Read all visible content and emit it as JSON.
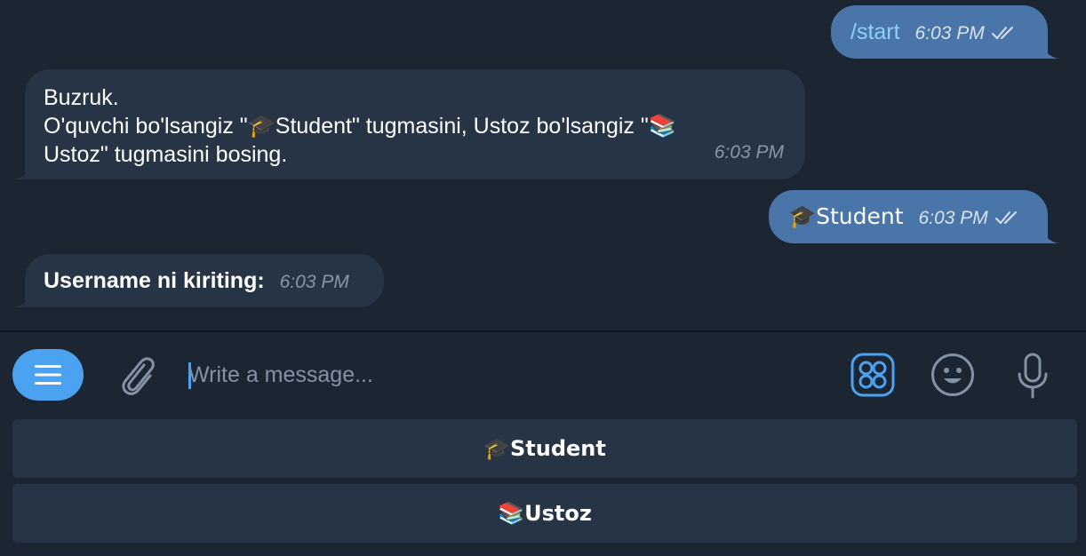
{
  "messages": [
    {
      "direction": "out",
      "text": "/start",
      "time": "6:03 PM",
      "read": true
    },
    {
      "direction": "in",
      "lines": [
        "Buzruk.",
        "O'quvchi bo'lsangiz \"🎓Student\" tugmasini, Ustoz bo'lsangiz \"📚",
        "Ustoz\" tugmasini bosing."
      ],
      "time": "6:03 PM"
    },
    {
      "direction": "out",
      "text": "🎓Student",
      "time": "6:03 PM",
      "read": true
    },
    {
      "direction": "in",
      "text": "Username ni kiriting:",
      "time": "6:03 PM"
    }
  ],
  "composer": {
    "placeholder": "Write a message...",
    "icons": {
      "menu": "menu-icon",
      "attach": "paperclip-icon",
      "apps": "apps-grid-icon",
      "emoji": "smiley-icon",
      "mic": "microphone-icon"
    }
  },
  "keyboard": {
    "buttons": [
      {
        "label": "🎓Student"
      },
      {
        "label": "📚Ustoz"
      }
    ]
  },
  "colors": {
    "background": "#1c2633",
    "bubble_in": "#273445",
    "bubble_out": "#4a75a8",
    "accent": "#4aa2f0"
  }
}
